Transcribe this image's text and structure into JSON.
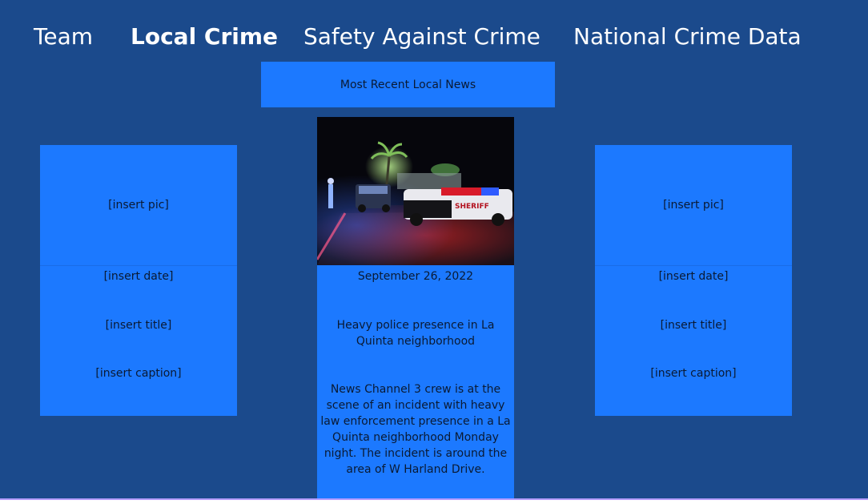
{
  "nav": {
    "team": "Team",
    "local_crime": "Local Crime",
    "safety": "Safety Against Crime",
    "national": "National Crime Data"
  },
  "banner": {
    "label": "Most Recent Local News"
  },
  "left_card": {
    "pic": "[insert pic]",
    "date": "[insert date]",
    "title": "[insert title]",
    "caption": "[insert caption]"
  },
  "center_card": {
    "photo_badge": "SHERIFF",
    "date": "September 26, 2022",
    "title_line1": "Heavy police presence in La",
    "title_line2": "Quinta neighborhood",
    "body_line1": "News Channel 3 crew is at the",
    "body_line2": "scene of an incident with heavy",
    "body_line3": "law enforcement presence in a La",
    "body_line4": "Quinta neighborhood Monday",
    "body_line5": "night. The incident is around the",
    "body_line6": "area of W Harland Drive."
  },
  "right_card": {
    "pic": "[insert pic]",
    "date": "[insert date]",
    "title": "[insert title]",
    "caption": "[insert caption]"
  }
}
